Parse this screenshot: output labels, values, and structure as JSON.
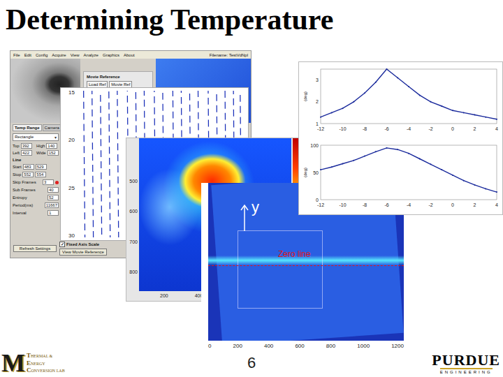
{
  "slide": {
    "title": "Determining Temperature",
    "page_number": "6"
  },
  "software_window": {
    "menu": [
      "File",
      "Edit",
      "Config",
      "Acquire",
      "View",
      "Analyze",
      "Graphics",
      "About"
    ],
    "status": "Filename: TestVdNpl",
    "movie_reference": {
      "label": "Movie Reference",
      "buttons": [
        "Load Ref",
        "Movie Ref"
      ]
    },
    "tabs": [
      {
        "label": "Temp Range",
        "selected": true
      },
      {
        "label": "Camera",
        "selected": false
      }
    ],
    "shape": "Rectangle",
    "rect_fields": [
      {
        "label": "Top",
        "value": "392"
      },
      {
        "label": "High",
        "value": "140"
      },
      {
        "label": "Left",
        "value": "422"
      },
      {
        "label": "Wide",
        "value": "152"
      }
    ],
    "line": {
      "label": "Line",
      "fields": [
        {
          "label": "Start",
          "values": [
            "483",
            "529"
          ]
        },
        {
          "label": "Stop",
          "values": [
            "552",
            "554"
          ]
        }
      ]
    },
    "settings": [
      {
        "label": "Skip Frames",
        "value": "3"
      },
      {
        "label": "Sub Frames",
        "value": "40"
      },
      {
        "label": "Entropy",
        "value": "52"
      },
      {
        "label": "Period(ms)",
        "value": "11667"
      },
      {
        "label": "Interval",
        "value": "1"
      }
    ],
    "indicator": {
      "on": true,
      "color": "#e02020"
    },
    "fixed_axis": {
      "label": "Fixed Axis Scale",
      "checked": true
    },
    "buttons": [
      "Refresh Settings",
      "View Movie Reference"
    ]
  },
  "fringe_plot": {
    "y_ticks": [
      "15",
      "20",
      "25",
      "30"
    ],
    "fringe_x": [
      0.04,
      0.09,
      0.14,
      0.19,
      0.24,
      0.3,
      0.35,
      0.4,
      0.46,
      0.51,
      0.57,
      0.62,
      0.67,
      0.72,
      0.78,
      0.83,
      0.88,
      0.93,
      0.97
    ]
  },
  "thermal_image": {
    "y_ticks": [
      "500",
      "600",
      "700",
      "800"
    ],
    "x_ticks": [
      "200",
      "400"
    ]
  },
  "angle_image": {
    "axis_label": "y",
    "zero_line_label": "Zero line",
    "x_ticks": [
      "0",
      "200",
      "400",
      "600",
      "800",
      "1000",
      "1200"
    ]
  },
  "profile_plots": [
    {
      "y_label": "(deg)",
      "y_ticks": [
        "3",
        "2",
        "1"
      ],
      "x_ticks": [
        "-12",
        "-10",
        "-8",
        "-6",
        "-4",
        "-2",
        "0",
        "2",
        "4"
      ],
      "values": [
        1.3,
        1.5,
        1.7,
        2.0,
        2.4,
        2.9,
        3.5,
        3.1,
        2.7,
        2.3,
        2.0,
        1.8,
        1.6,
        1.5,
        1.4,
        1.3,
        1.2
      ]
    },
    {
      "y_label": "(deg)",
      "y_ticks": [
        "100",
        "50",
        "0"
      ],
      "x_ticks": [
        "-12",
        "-10",
        "-8",
        "-6",
        "-4",
        "-2",
        "0",
        "2",
        "4"
      ],
      "values": [
        55,
        60,
        66,
        72,
        80,
        88,
        95,
        92,
        85,
        75,
        65,
        55,
        45,
        35,
        27,
        20,
        14
      ]
    }
  ],
  "logos": {
    "lab": {
      "letter": "M",
      "lines": [
        "THERMAL &",
        "ENERGY",
        "CONVERSION LAB"
      ]
    },
    "purdue": {
      "name": "PURDUE",
      "sub": "ENGINEERING"
    }
  }
}
